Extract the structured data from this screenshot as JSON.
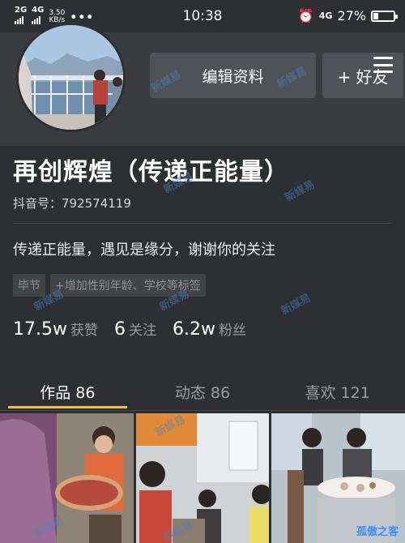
{
  "status_bar": {
    "net1": "2G",
    "net2": "4G",
    "speed_value": "3.50",
    "speed_unit": "KB/s",
    "time": "10:38",
    "net3": "4G",
    "battery": "27%",
    "battery_level": 0.27
  },
  "header": {
    "edit_profile": "编辑资料",
    "add_friend": "+ 好友"
  },
  "profile": {
    "name": "再创辉煌（传递正能量）",
    "account": "抖音号：792574119",
    "bio": "传递正能量，遇见是缘分，谢谢你的关注",
    "tags": [
      "毕节",
      "+增加性别年龄、学校等标签"
    ]
  },
  "stats": [
    {
      "num": "17.5w",
      "label": "获赞"
    },
    {
      "num": "6",
      "label": "关注"
    },
    {
      "num": "6.2w",
      "label": "粉丝"
    }
  ],
  "tabs": [
    {
      "label": "作品 86"
    },
    {
      "label": "动态 86"
    },
    {
      "label": "喜欢 121"
    }
  ],
  "watermark": "新媒易",
  "site_mark": "孤傲之客",
  "colors": {
    "background": "#2e2f33",
    "accent": "#f5c233"
  }
}
